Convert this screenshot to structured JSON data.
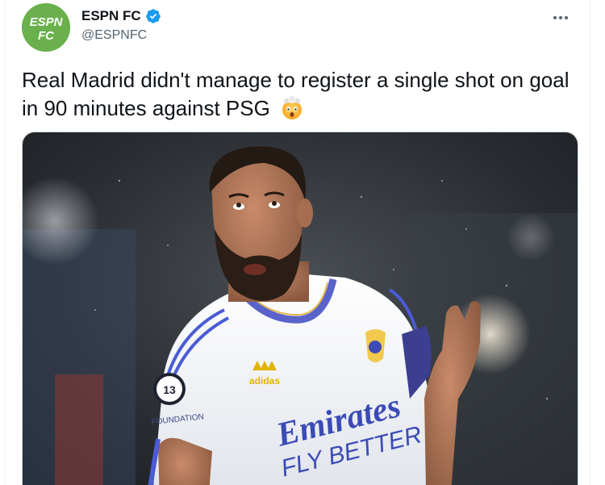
{
  "author": {
    "display_name": "ESPN FC",
    "handle": "@ESPNFC",
    "avatar_text_top": "ESPN",
    "avatar_text_bottom": "FC",
    "avatar_color": "#6ab04c",
    "verified_color": "#1d9bf0"
  },
  "tweet": {
    "text": "Real Madrid didn't manage to register a single shot on goal in 90 minutes against PSG",
    "emoji": "exploding-head-emoji"
  },
  "media": {
    "shirt_sponsor_line1": "Emirates",
    "shirt_sponsor_line2": "FLY BETTER",
    "kit_brand": "adidas",
    "sleeve_badge": "FOUNDATION"
  },
  "actions": {
    "more_icon": "more-icon"
  }
}
